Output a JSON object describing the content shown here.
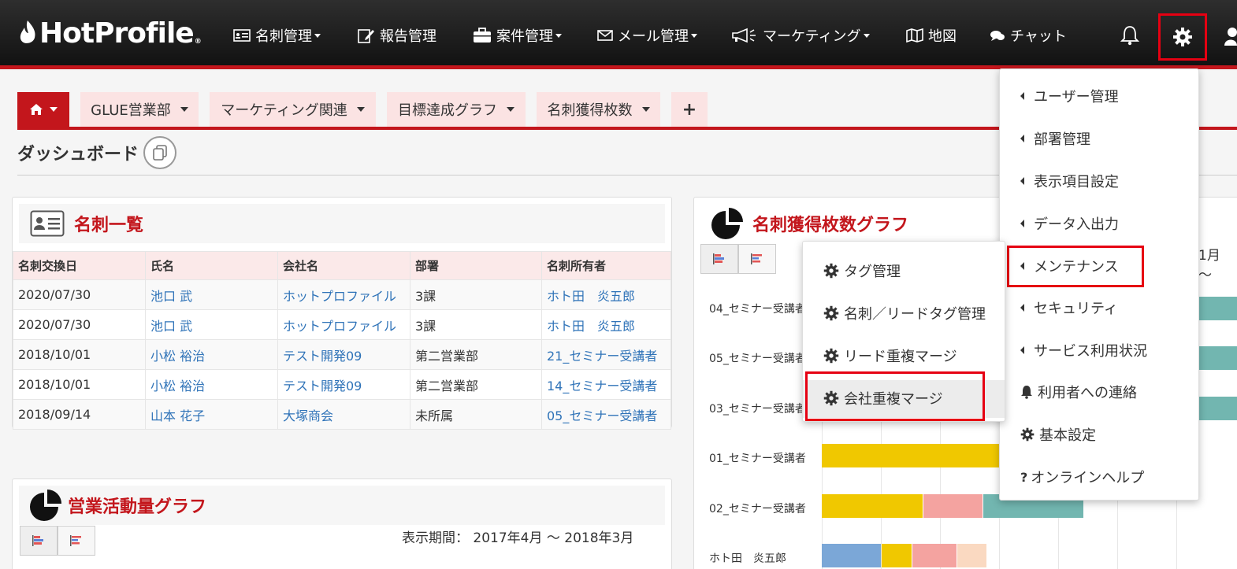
{
  "app": {
    "logo": "HotProfile",
    "logo_mark": "®"
  },
  "nav": [
    {
      "label": "名刺管理",
      "icon": "card-icon",
      "dropdown": true
    },
    {
      "label": "報告管理",
      "icon": "report-edit-icon",
      "dropdown": false
    },
    {
      "label": "案件管理",
      "icon": "briefcase-icon",
      "dropdown": true
    },
    {
      "label": "メール管理",
      "icon": "mail-icon",
      "dropdown": true
    },
    {
      "label": "マーケティング",
      "icon": "megaphone-icon",
      "dropdown": true
    },
    {
      "label": "地図",
      "icon": "map-icon",
      "dropdown": false
    },
    {
      "label": "チャット",
      "icon": "chat-icon",
      "dropdown": false
    }
  ],
  "tabs": [
    {
      "label": "",
      "icon": "home-icon"
    },
    {
      "label": "GLUE営業部"
    },
    {
      "label": "マーケティング関連"
    },
    {
      "label": "目標達成グラフ"
    },
    {
      "label": "名刺獲得枚数"
    },
    {
      "label": "+"
    }
  ],
  "page": {
    "title": "ダッシュボード"
  },
  "cards_panel": {
    "title": "名刺一覧",
    "columns": [
      "名刺交換日",
      "氏名",
      "会社名",
      "部署",
      "名刺所有者"
    ],
    "rows": [
      [
        "2020/07/30",
        "池口 武",
        "ホットプロファイル",
        "3課",
        "ホト田　炎五郎"
      ],
      [
        "2020/07/30",
        "池口 武",
        "ホットプロファイル",
        "3課",
        "ホト田　炎五郎"
      ],
      [
        "2018/10/01",
        "小松 裕治",
        "テスト開発09",
        "第二営業部",
        "21_セミナー受講者"
      ],
      [
        "2018/10/01",
        "小松 裕治",
        "テスト開発09",
        "第二営業部",
        "14_セミナー受講者"
      ],
      [
        "2018/09/14",
        "山本 花子",
        "大塚商会",
        "未所属",
        "05_セミナー受講者"
      ]
    ]
  },
  "activity_panel": {
    "title": "営業活動量グラフ",
    "period_label": "表示期間：",
    "period_value": "2017年4月 ～ 2018年3月"
  },
  "card_graph_panel": {
    "title": "名刺獲得枚数グラフ",
    "month_label": "1月 ～"
  },
  "chart_data": {
    "type": "bar",
    "orientation": "horizontal",
    "stacked": true,
    "categories": [
      "04_セミナー受講者",
      "05_セミナー受講者",
      "03_セミナー受講者",
      "01_セミナー受講者",
      "02_セミナー受講者",
      "ホト田　炎五郎"
    ],
    "colors": [
      "#7ba7d7",
      "#f0c800",
      "#f4a3a0",
      "#fad9c1",
      "#72b6b0"
    ],
    "visible_bars": [
      {
        "category": "01_セミナー受講者",
        "segments": [
          {
            "color": "#f0c800",
            "value": 3
          }
        ]
      },
      {
        "category": "02_セミナー受講者",
        "segments": [
          {
            "color": "#f0c800",
            "value": 1.7
          },
          {
            "color": "#f4a3a0",
            "value": 1
          },
          {
            "color": "#72b6b0",
            "value": 1.7
          }
        ]
      },
      {
        "category": "ホト田　炎五郎",
        "segments": [
          {
            "color": "#7ba7d7",
            "value": 1
          },
          {
            "color": "#f0c800",
            "value": 0.5
          },
          {
            "color": "#f4a3a0",
            "value": 0.75
          },
          {
            "color": "#fad9c1",
            "value": 0.5
          }
        ]
      }
    ]
  },
  "settings_menu": {
    "items": [
      {
        "label": "ユーザー管理",
        "icon": "caret-left-icon"
      },
      {
        "label": "部署管理",
        "icon": "caret-left-icon"
      },
      {
        "label": "表示項目設定",
        "icon": "caret-left-icon"
      },
      {
        "label": "データ入出力",
        "icon": "caret-left-icon"
      },
      {
        "label": "メンテナンス",
        "icon": "caret-left-icon",
        "highlighted": true
      },
      {
        "label": "セキュリティ",
        "icon": "caret-left-icon"
      },
      {
        "label": "サービス利用状況",
        "icon": "caret-left-icon"
      },
      {
        "label": "利用者への連絡",
        "icon": "bell-icon"
      },
      {
        "label": "基本設定",
        "icon": "gear-icon"
      },
      {
        "label": "オンラインヘルプ",
        "icon": "question-icon"
      }
    ]
  },
  "maintenance_submenu": {
    "items": [
      {
        "label": "タグ管理"
      },
      {
        "label": "名刺／リードタグ管理"
      },
      {
        "label": "リード重複マージ"
      },
      {
        "label": "会社重複マージ",
        "highlighted": true
      }
    ]
  },
  "colors": {
    "brand_red": "#c3161c",
    "highlight_red": "#e60012",
    "link_blue": "#2f73b8"
  }
}
